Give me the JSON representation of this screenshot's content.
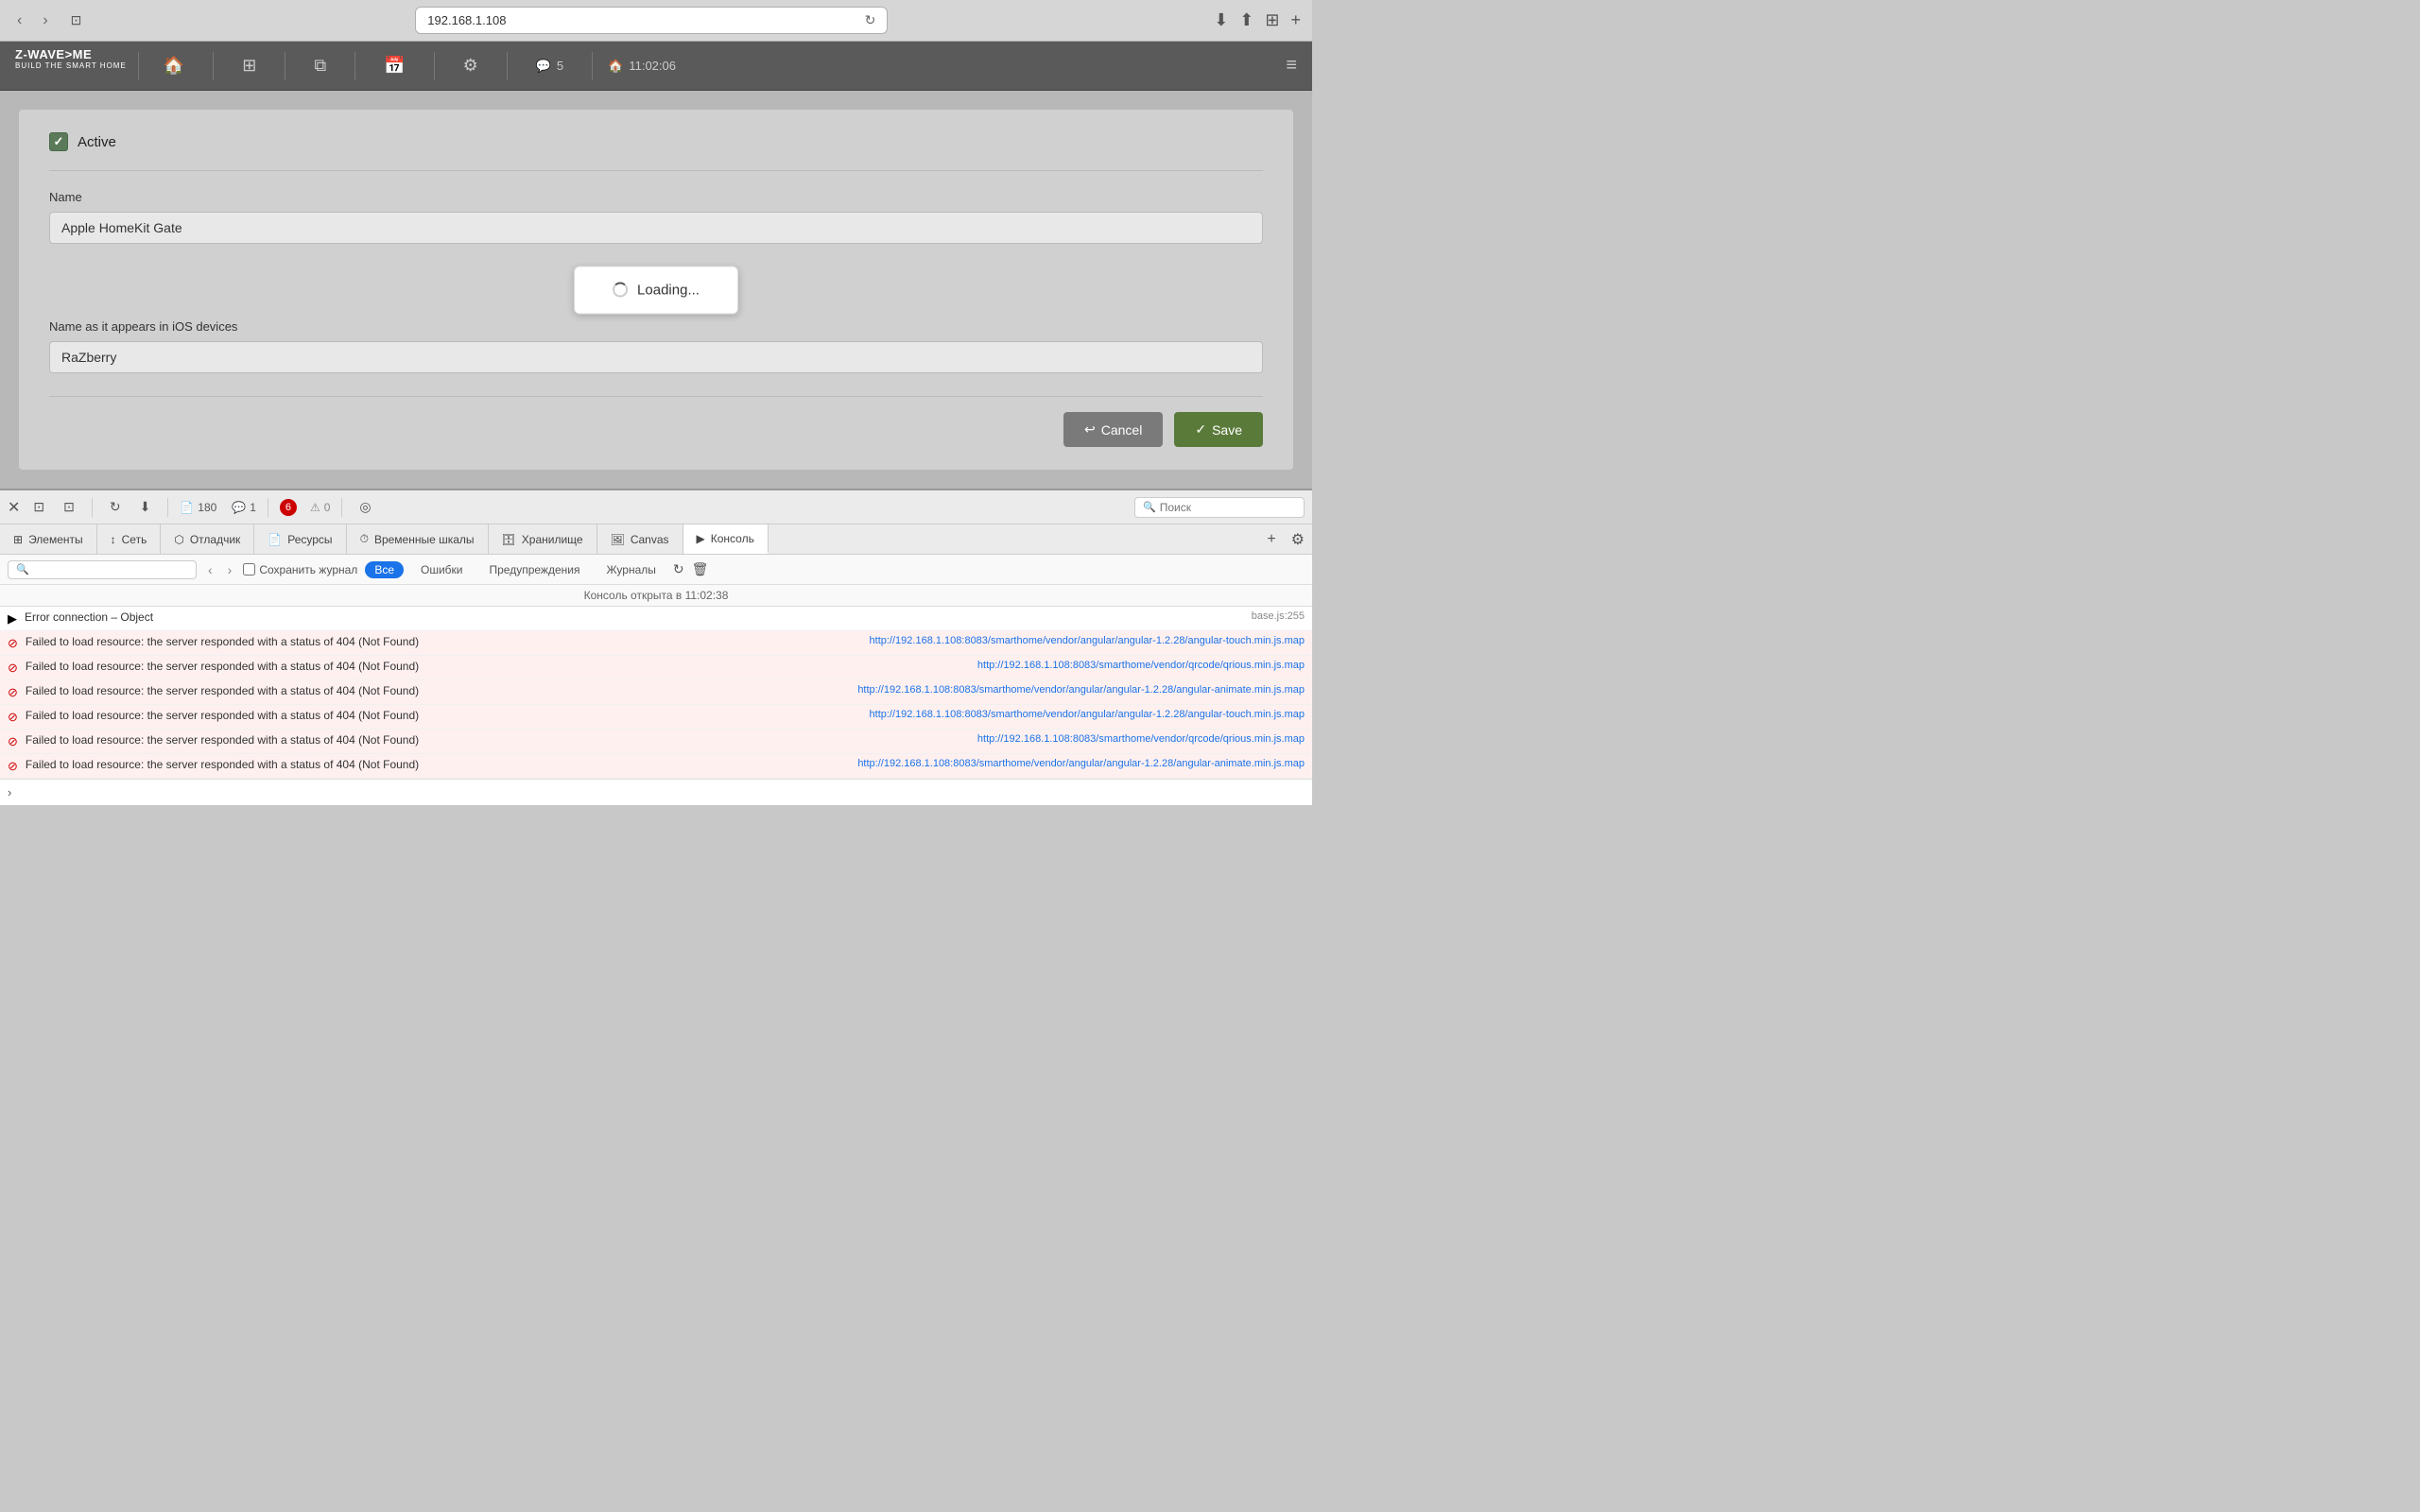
{
  "browser": {
    "address": "192.168.1.108",
    "reload_icon": "↻",
    "back_icon": "‹",
    "forward_icon": "›",
    "tab_icon": "⊡",
    "download_icon": "⬇",
    "share_icon": "⬆",
    "sidebar_icon": "⊞",
    "add_tab_icon": "+"
  },
  "app_header": {
    "logo_main": "Z-WAVE>ME",
    "logo_sub": "BUILD THE SMART HOME",
    "nav_home_icon": "🏠",
    "nav_grid_icon": "⊞",
    "nav_copy_icon": "⧉",
    "nav_calendar_icon": "📅",
    "nav_settings_icon": "⚙",
    "nav_chat_icon": "💬",
    "chat_count": "5",
    "time_icon": "🏠",
    "time": "11:02:06",
    "menu_icon": "≡"
  },
  "form": {
    "active_label": "Active",
    "name_label": "Name",
    "name_value": "Apple HomeKit Gate",
    "name_ios_label": "Name as it appears in iOS devices",
    "name_ios_value": "RaZberry",
    "loading_text": "Loading...",
    "cancel_label": "Cancel",
    "save_label": "Save",
    "cancel_icon": "↩",
    "save_icon": "✓"
  },
  "devtools": {
    "close_icon": "✕",
    "dock_icon": "⊡",
    "inspect_icon": "⊡",
    "reload_icon": "↻",
    "download_icon": "⬇",
    "page_count": "180",
    "chat_icon": "💬",
    "error_count": "6",
    "warn_count": "0",
    "comments_count": "1",
    "location_icon": "◎",
    "search_placeholder": "Поиск",
    "tabs": [
      {
        "icon": "⊞",
        "label": "Элементы"
      },
      {
        "icon": "↕",
        "label": "Сеть"
      },
      {
        "icon": "⬡",
        "label": "Отладчик"
      },
      {
        "icon": "📄",
        "label": "Ресурсы"
      },
      {
        "icon": "⏱",
        "label": "Временные шкалы"
      },
      {
        "icon": "🗄",
        "label": "Хранилище"
      },
      {
        "icon": "🖼",
        "label": "Canvas"
      },
      {
        "icon": "▶",
        "label": "Консоль"
      }
    ],
    "active_tab_index": 7,
    "filter_all": "Все",
    "filter_errors": "Ошибки",
    "filter_warnings": "Предупреждения",
    "filter_logs": "Журналы",
    "preserve_log": "Сохранить журнал",
    "console_opened": "Консоль открыта в 11:02:38",
    "console_entries": [
      {
        "type": "object",
        "expandable": true,
        "message": "Error connection – Object",
        "source": "base.js:255"
      },
      {
        "type": "error",
        "message": "Failed to load resource: the server responded with a status of 404 (Not Found)",
        "source": "http://192.168.1.108:8083/smarthome/vendor/angular/angular-1.2.28/angular-touch.min.js.map"
      },
      {
        "type": "error",
        "message": "Failed to load resource: the server responded with a status of 404 (Not Found)",
        "source": "http://192.168.1.108:8083/smarthome/vendor/qrcode/qrious.min.js.map"
      },
      {
        "type": "error",
        "message": "Failed to load resource: the server responded with a status of 404 (Not Found)",
        "source": "http://192.168.1.108:8083/smarthome/vendor/angular/angular-1.2.28/angular-animate.min.js.map"
      },
      {
        "type": "error",
        "message": "Failed to load resource: the server responded with a status of 404 (Not Found)",
        "source": "http://192.168.1.108:8083/smarthome/vendor/angular/angular-1.2.28/angular-touch.min.js.map"
      },
      {
        "type": "error",
        "message": "Failed to load resource: the server responded with a status of 404 (Not Found)",
        "source": "http://192.168.1.108:8083/smarthome/vendor/qrcode/qrious.min.js.map"
      },
      {
        "type": "error",
        "message": "Failed to load resource: the server responded with a status of 404 (Not Found)",
        "source": "http://192.168.1.108:8083/smarthome/vendor/angular/angular-1.2.28/angular-animate.min.js.map"
      }
    ]
  }
}
